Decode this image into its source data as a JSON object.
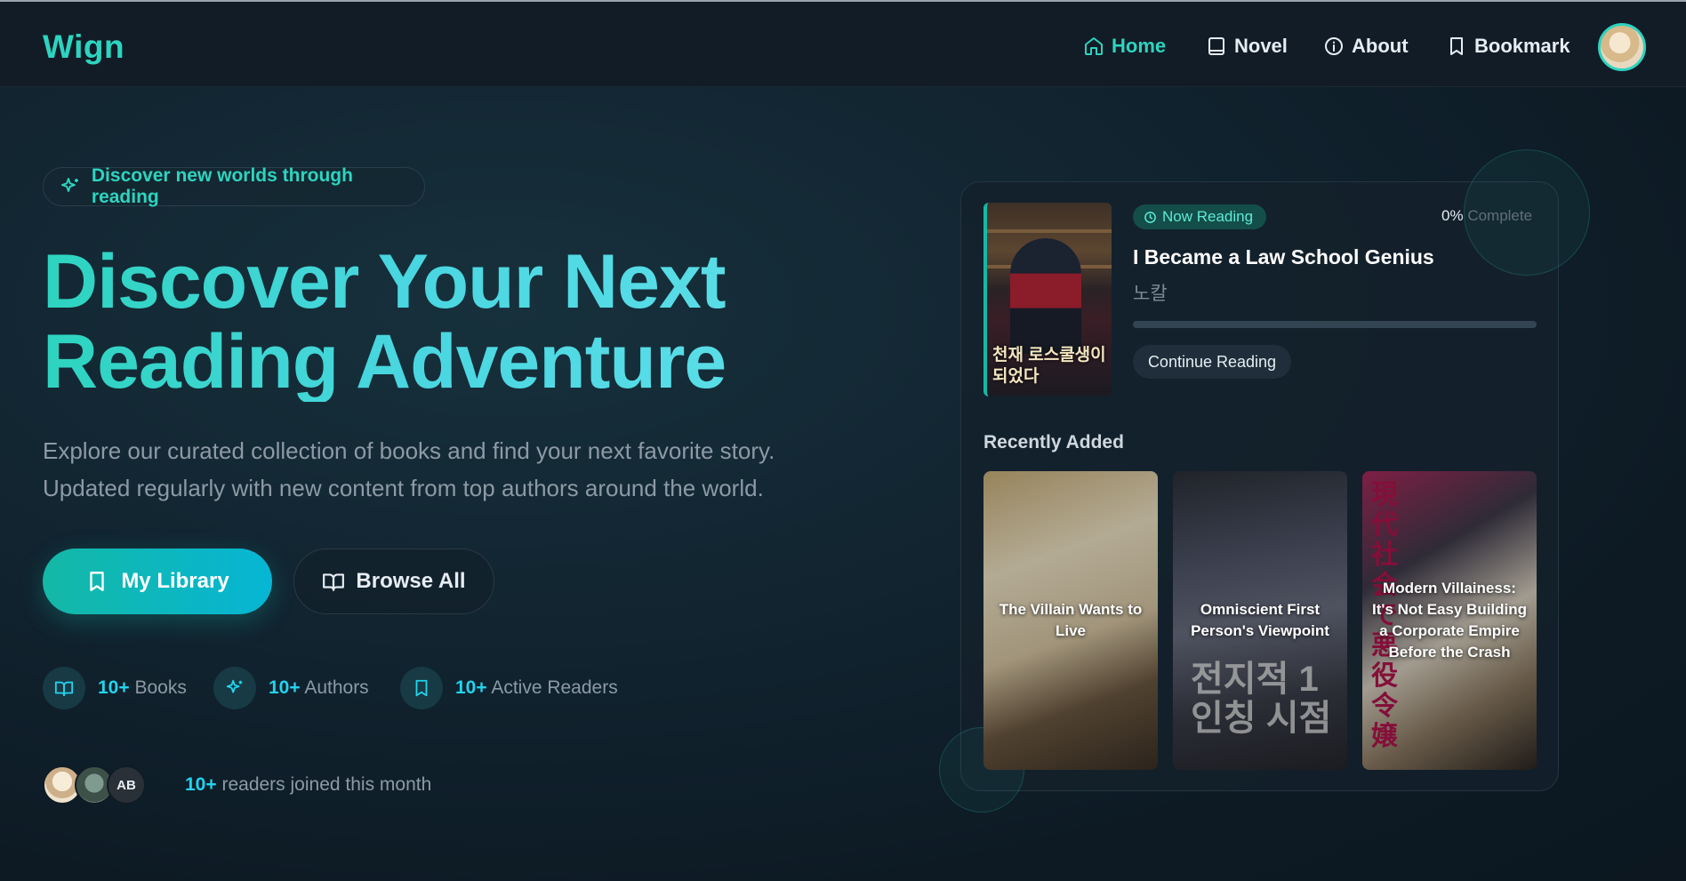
{
  "nav": {
    "brand": "Wign",
    "items": [
      {
        "label": "Home",
        "icon": "home-icon",
        "active": true
      },
      {
        "label": "Novel",
        "icon": "book-icon"
      },
      {
        "label": "About",
        "icon": "info-icon"
      },
      {
        "label": "Bookmark",
        "icon": "bookmark-icon"
      }
    ]
  },
  "hero": {
    "pill": "Discover new worlds through reading",
    "title_line1": "Discover Your Next",
    "title_line2": "Reading Adventure",
    "subtitle_line1": "Explore our curated collection of books and find your next favorite story.",
    "subtitle_line2": "Updated regularly with new content from top authors around the world.",
    "primary_button": "My Library",
    "secondary_button": "Browse All"
  },
  "stats": [
    {
      "num": "10+",
      "label": "Books",
      "icon": "book-open-icon"
    },
    {
      "num": "10+",
      "label": "Authors",
      "icon": "sparkles-icon"
    },
    {
      "num": "10+",
      "label": "Active Readers",
      "icon": "bookmark-icon"
    }
  ],
  "readers": {
    "num": "10+",
    "text": "readers joined this month",
    "avatar3_text": "AB"
  },
  "now_reading": {
    "badge": "Now Reading",
    "percent": "0%",
    "percent_label": "Complete",
    "progress": 0,
    "title": "I Became a Law School Genius",
    "author": "노칼",
    "cover_text": "천재 로스쿨생이 되었다",
    "button": "Continue Reading"
  },
  "recent": {
    "label": "Recently Added",
    "items": [
      {
        "title": "The Villain Wants to Live"
      },
      {
        "title": "Omniscient First Person's Viewpoint",
        "cover_text": "전지적 1인칭 시점"
      },
      {
        "title": "Modern Villainess: It's Not Easy Building a Corporate Empire Before the Crash",
        "cover_text": "現代社会で悪役令嬢"
      }
    ]
  },
  "colors": {
    "accent": "#2dd4bf",
    "cyan": "#22d3ee",
    "background": "#112430"
  }
}
